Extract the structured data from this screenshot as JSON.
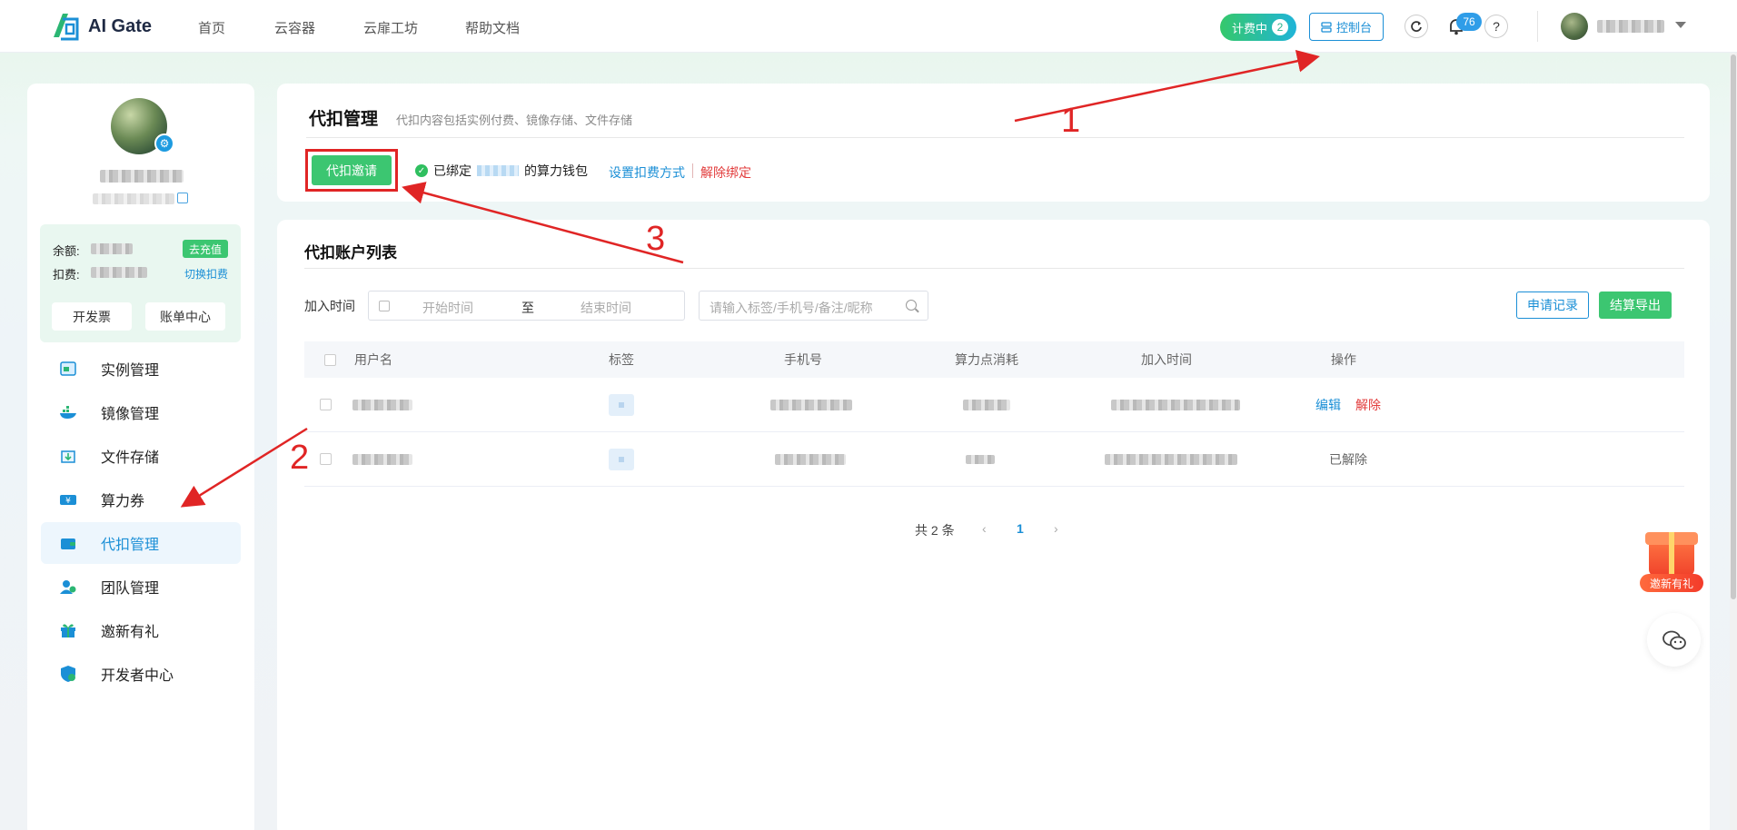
{
  "brand": {
    "name": "AI Gate"
  },
  "nav": {
    "items": [
      "首页",
      "云容器",
      "云扉工坊",
      "帮助文档"
    ]
  },
  "topbar": {
    "billing_label": "计费中",
    "billing_count": "2",
    "console_label": "控制台",
    "notification_count": "76",
    "help_glyph": "?"
  },
  "sidebar": {
    "balance_label": "余额:",
    "deduct_label": "扣费:",
    "recharge_label": "去充值",
    "switch_label": "切换扣费",
    "invoice_label": "开发票",
    "bill_center_label": "账单中心",
    "menu": [
      {
        "label": "实例管理",
        "icon": "instance-icon"
      },
      {
        "label": "镜像管理",
        "icon": "docker-image-icon"
      },
      {
        "label": "文件存储",
        "icon": "file-storage-icon"
      },
      {
        "label": "算力券",
        "icon": "voucher-icon"
      },
      {
        "label": "代扣管理",
        "icon": "wallet-icon"
      },
      {
        "label": "团队管理",
        "icon": "team-icon"
      },
      {
        "label": "邀新有礼",
        "icon": "gift-icon"
      },
      {
        "label": "开发者中心",
        "icon": "developer-shield-icon"
      }
    ],
    "active_index": 4
  },
  "header_card": {
    "title": "代扣管理",
    "subtitle": "代扣内容包括实例付费、镜像存储、文件存储",
    "invite_button": "代扣邀请",
    "bound_prefix": "已绑定",
    "bound_suffix": "的算力钱包",
    "set_method_link": "设置扣费方式",
    "unbind_link": "解除绑定"
  },
  "list_card": {
    "title": "代扣账户列表",
    "join_time_label": "加入时间",
    "start_placeholder": "开始时间",
    "range_separator": "至",
    "end_placeholder": "结束时间",
    "search_placeholder": "请输入标签/手机号/备注/昵称",
    "apply_record_button": "申请记录",
    "export_button": "结算导出",
    "columns": [
      "用户名",
      "标签",
      "手机号",
      "算力点消耗",
      "加入时间",
      "操作"
    ],
    "rows": [
      {
        "actions": [
          "编辑",
          "解除"
        ],
        "status": ""
      },
      {
        "actions": [],
        "status": "已解除"
      }
    ],
    "pagination": {
      "total_text": "共 2 条",
      "current_page": "1"
    }
  },
  "floats": {
    "invite_gift_label": "邀新有礼"
  },
  "annotations": [
    "1",
    "2",
    "3"
  ],
  "colors": {
    "primary_green": "#3cc671",
    "link_blue": "#1b8fd6",
    "danger_red": "#e23c3c",
    "annotation_red": "#e02525"
  }
}
